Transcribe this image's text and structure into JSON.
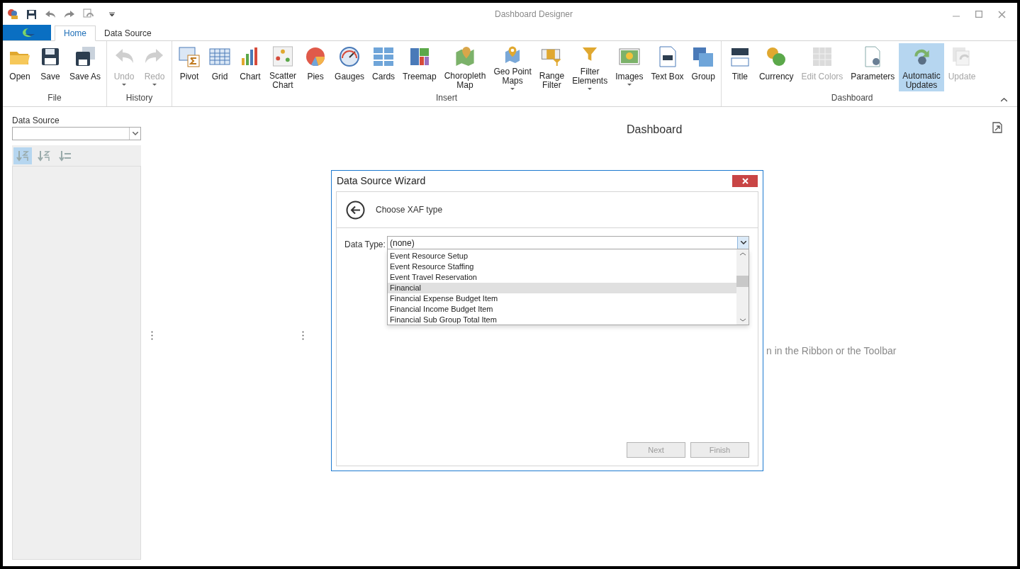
{
  "window": {
    "title": "Dashboard Designer"
  },
  "ribbon": {
    "tabs": [
      {
        "label": "Home",
        "selected": true
      },
      {
        "label": "Data Source",
        "selected": false
      }
    ],
    "groups": [
      {
        "label": "File",
        "items": [
          {
            "label": "Open",
            "dropdown": false,
            "disabled": false,
            "selected": false
          },
          {
            "label": "Save",
            "dropdown": false,
            "disabled": false,
            "selected": false
          },
          {
            "label": "Save As",
            "dropdown": false,
            "disabled": false,
            "selected": false
          }
        ]
      },
      {
        "label": "History",
        "items": [
          {
            "label": "Undo",
            "dropdown": true,
            "disabled": true,
            "selected": false
          },
          {
            "label": "Redo",
            "dropdown": true,
            "disabled": true,
            "selected": false
          }
        ]
      },
      {
        "label": "Insert",
        "items": [
          {
            "label": "Pivot",
            "dropdown": false,
            "disabled": false,
            "selected": false
          },
          {
            "label": "Grid",
            "dropdown": false,
            "disabled": false,
            "selected": false
          },
          {
            "label": "Chart",
            "dropdown": false,
            "disabled": false,
            "selected": false
          },
          {
            "label": "Scatter\nChart",
            "dropdown": false,
            "disabled": false,
            "selected": false
          },
          {
            "label": "Pies",
            "dropdown": false,
            "disabled": false,
            "selected": false
          },
          {
            "label": "Gauges",
            "dropdown": false,
            "disabled": false,
            "selected": false
          },
          {
            "label": "Cards",
            "dropdown": false,
            "disabled": false,
            "selected": false
          },
          {
            "label": "Treemap",
            "dropdown": false,
            "disabled": false,
            "selected": false
          },
          {
            "label": "Choropleth\nMap",
            "dropdown": false,
            "disabled": false,
            "selected": false
          },
          {
            "label": "Geo Point\nMaps",
            "dropdown": true,
            "disabled": false,
            "selected": false
          },
          {
            "label": "Range\nFilter",
            "dropdown": false,
            "disabled": false,
            "selected": false
          },
          {
            "label": "Filter\nElements",
            "dropdown": true,
            "disabled": false,
            "selected": false
          },
          {
            "label": "Images",
            "dropdown": true,
            "disabled": false,
            "selected": false
          },
          {
            "label": "Text Box",
            "dropdown": false,
            "disabled": false,
            "selected": false
          },
          {
            "label": "Group",
            "dropdown": false,
            "disabled": false,
            "selected": false
          }
        ]
      },
      {
        "label": "Dashboard",
        "items": [
          {
            "label": "Title",
            "dropdown": false,
            "disabled": false,
            "selected": false
          },
          {
            "label": "Currency",
            "dropdown": false,
            "disabled": false,
            "selected": false
          },
          {
            "label": "Edit Colors",
            "dropdown": false,
            "disabled": true,
            "selected": false
          },
          {
            "label": "Parameters",
            "dropdown": false,
            "disabled": false,
            "selected": false
          },
          {
            "label": "Automatic\nUpdates",
            "dropdown": false,
            "disabled": false,
            "selected": true
          },
          {
            "label": "Update",
            "dropdown": false,
            "disabled": true,
            "selected": false
          }
        ]
      }
    ]
  },
  "data_source_panel": {
    "label": "Data Source",
    "sort_tools": [
      {
        "selected": true
      },
      {
        "selected": false
      },
      {
        "selected": false
      }
    ]
  },
  "dashboard": {
    "title": "Dashboard",
    "hint": "n in the Ribbon or the Toolbar"
  },
  "dialog": {
    "title": "Data Source Wizard",
    "step": "Choose XAF type",
    "field_label": "Data Type:",
    "value": "(none)",
    "options": [
      {
        "label": "Event Resource Setup",
        "selected": false
      },
      {
        "label": "Event Resource Staffing",
        "selected": false
      },
      {
        "label": "Event Travel Reservation",
        "selected": false
      },
      {
        "label": "Financial",
        "selected": true
      },
      {
        "label": "Financial Expense Budget Item",
        "selected": false
      },
      {
        "label": "Financial Income Budget Item",
        "selected": false
      },
      {
        "label": "Financial Sub Group Total Item",
        "selected": false
      }
    ],
    "buttons": [
      {
        "label": "Next",
        "disabled": true
      },
      {
        "label": "Finish",
        "disabled": true
      }
    ]
  }
}
